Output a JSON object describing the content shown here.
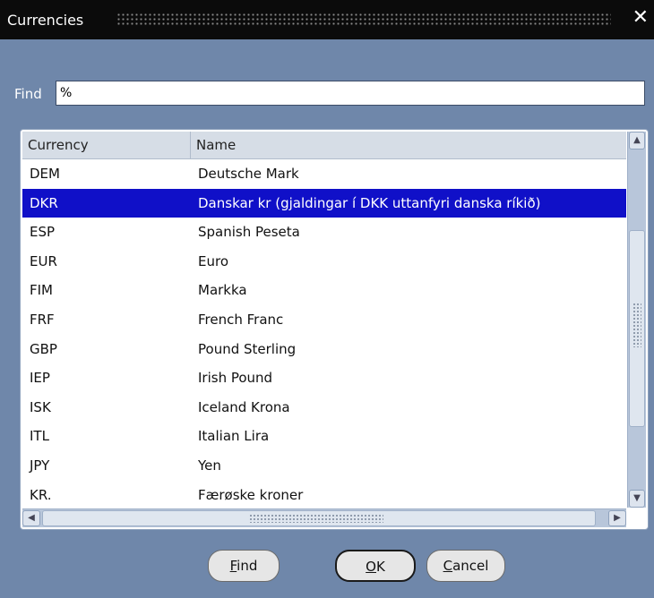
{
  "window": {
    "title": "Currencies",
    "close_glyph": "✕"
  },
  "find": {
    "label": "Find",
    "value": "%"
  },
  "grid": {
    "columns": [
      "Currency",
      "Name"
    ],
    "selected_index": 1,
    "rows": [
      {
        "code": "DEM",
        "name": "Deutsche Mark"
      },
      {
        "code": "DKR",
        "name": "Danskar kr (gjaldingar í DKK uttanfyri danska ríkið)"
      },
      {
        "code": "ESP",
        "name": "Spanish Peseta"
      },
      {
        "code": "EUR",
        "name": "Euro"
      },
      {
        "code": "FIM",
        "name": "Markka"
      },
      {
        "code": "FRF",
        "name": "French Franc"
      },
      {
        "code": "GBP",
        "name": "Pound Sterling"
      },
      {
        "code": "IEP",
        "name": "Irish Pound"
      },
      {
        "code": "ISK",
        "name": "Iceland Krona"
      },
      {
        "code": "ITL",
        "name": "Italian Lira"
      },
      {
        "code": "JPY",
        "name": "Yen"
      },
      {
        "code": "KR.",
        "name": "Færøske kroner"
      }
    ]
  },
  "buttons": {
    "find": {
      "mnemonic": "F",
      "rest": "ind"
    },
    "ok": {
      "mnemonic": "O",
      "rest": "K"
    },
    "cancel": {
      "mnemonic": "C",
      "rest": "ancel"
    }
  },
  "colors": {
    "background": "#6f87aa",
    "titlebar": "#0b0b0b",
    "selection": "#1010c8"
  },
  "icons": {
    "scroll_up": "▲",
    "scroll_down": "▼",
    "scroll_left": "◀",
    "scroll_right": "▶"
  }
}
